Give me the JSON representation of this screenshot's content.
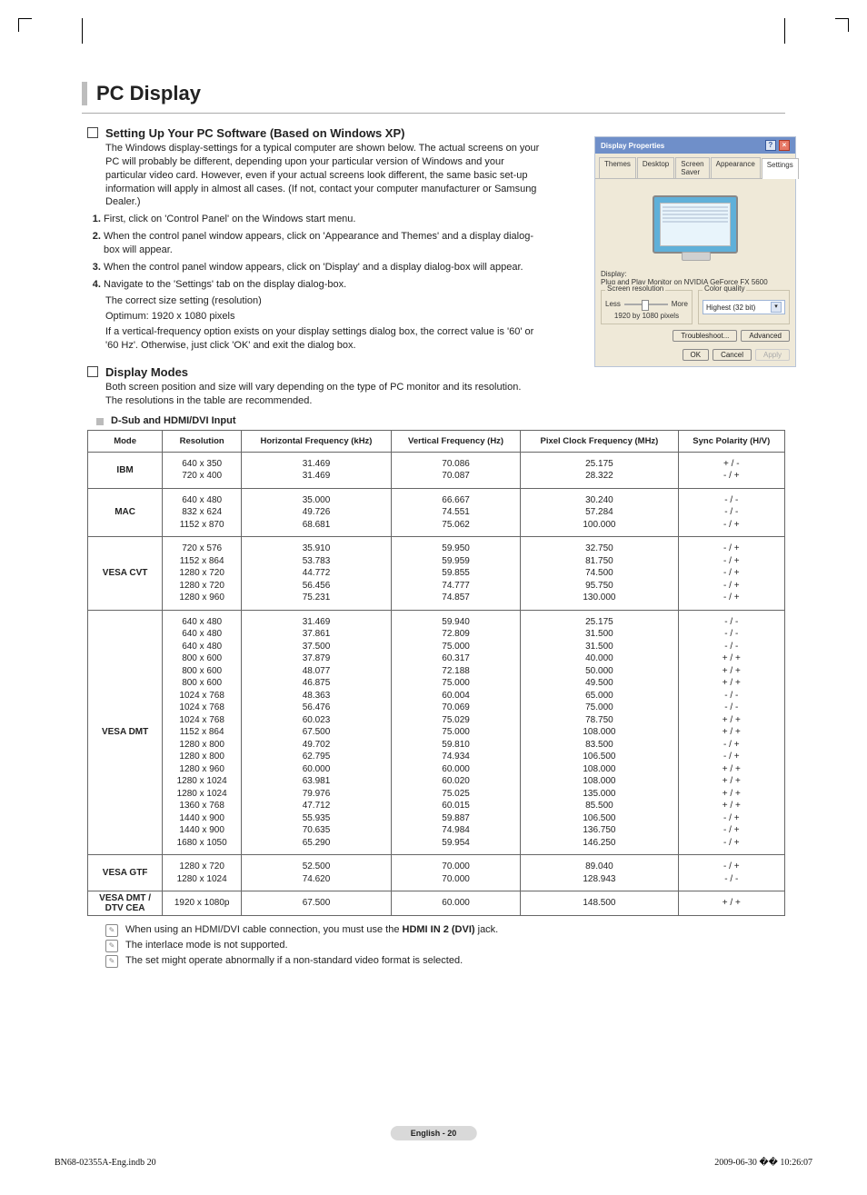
{
  "page_title": "PC Display",
  "section1": {
    "heading": "Setting Up Your PC Software (Based on Windows XP)",
    "intro": "The Windows display-settings for a typical computer are shown below. The actual screens on your PC will probably be different, depending upon your particular version of Windows and your particular video card. However, even if your actual screens look different, the same basic set-up information will apply in almost all cases. (If not, contact your computer manufacturer or Samsung Dealer.)",
    "steps": [
      "First, click on 'Control Panel' on the Windows start menu.",
      "When the control panel window appears, click on 'Appearance and Themes' and a display dialog-box will appear.",
      "When the control panel window appears, click on 'Display' and a display dialog-box will appear.",
      "Navigate to the 'Settings' tab on the display dialog-box."
    ],
    "after_steps": [
      "The correct size setting (resolution)",
      "Optimum: 1920 x 1080 pixels",
      "If a vertical-frequency option exists on your display settings dialog box, the correct value is '60' or '60 Hz'. Otherwise, just click 'OK' and exit the dialog box."
    ]
  },
  "section2": {
    "heading": "Display Modes",
    "body1": "Both screen position and size will vary depending on the type of PC monitor and its resolution.",
    "body2": "The resolutions in the table are recommended.",
    "subheading": "D-Sub and HDMI/DVI Input"
  },
  "table": {
    "headers": [
      "Mode",
      "Resolution",
      "Horizontal Frequency (kHz)",
      "Vertical Frequency (Hz)",
      "Pixel Clock Frequency (MHz)",
      "Sync Polarity (H/V)"
    ],
    "groups": [
      {
        "mode": "IBM",
        "rows": [
          [
            "640 x 350",
            "31.469",
            "70.086",
            "25.175",
            "+ / -"
          ],
          [
            "720 x 400",
            "31.469",
            "70.087",
            "28.322",
            "- / +"
          ]
        ]
      },
      {
        "mode": "MAC",
        "rows": [
          [
            "640 x 480",
            "35.000",
            "66.667",
            "30.240",
            "- / -"
          ],
          [
            "832 x 624",
            "49.726",
            "74.551",
            "57.284",
            "- / -"
          ],
          [
            "1152 x 870",
            "68.681",
            "75.062",
            "100.000",
            "- / +"
          ]
        ]
      },
      {
        "mode": "VESA CVT",
        "rows": [
          [
            "720 x 576",
            "35.910",
            "59.950",
            "32.750",
            "- / +"
          ],
          [
            "1152 x 864",
            "53.783",
            "59.959",
            "81.750",
            "- / +"
          ],
          [
            "1280 x 720",
            "44.772",
            "59.855",
            "74.500",
            "- / +"
          ],
          [
            "1280 x 720",
            "56.456",
            "74.777",
            "95.750",
            "- / +"
          ],
          [
            "1280 x 960",
            "75.231",
            "74.857",
            "130.000",
            "- / +"
          ]
        ]
      },
      {
        "mode": "VESA DMT",
        "rows": [
          [
            "640 x 480",
            "31.469",
            "59.940",
            "25.175",
            "- / -"
          ],
          [
            "640 x 480",
            "37.861",
            "72.809",
            "31.500",
            "- / -"
          ],
          [
            "640 x 480",
            "37.500",
            "75.000",
            "31.500",
            "- / -"
          ],
          [
            "800 x 600",
            "37.879",
            "60.317",
            "40.000",
            "+ / +"
          ],
          [
            "800 x 600",
            "48.077",
            "72.188",
            "50.000",
            "+ / +"
          ],
          [
            "800 x 600",
            "46.875",
            "75.000",
            "49.500",
            "+ / +"
          ],
          [
            "1024 x 768",
            "48.363",
            "60.004",
            "65.000",
            "- / -"
          ],
          [
            "1024 x 768",
            "56.476",
            "70.069",
            "75.000",
            "- / -"
          ],
          [
            "1024 x 768",
            "60.023",
            "75.029",
            "78.750",
            "+ / +"
          ],
          [
            "1152 x 864",
            "67.500",
            "75.000",
            "108.000",
            "+ / +"
          ],
          [
            "1280 x 800",
            "49.702",
            "59.810",
            "83.500",
            "- / +"
          ],
          [
            "1280 x 800",
            "62.795",
            "74.934",
            "106.500",
            "- / +"
          ],
          [
            "1280 x 960",
            "60.000",
            "60.000",
            "108.000",
            "+ / +"
          ],
          [
            "1280 x 1024",
            "63.981",
            "60.020",
            "108.000",
            "+ / +"
          ],
          [
            "1280 x 1024",
            "79.976",
            "75.025",
            "135.000",
            "+ / +"
          ],
          [
            "1360 x 768",
            "47.712",
            "60.015",
            "85.500",
            "+ / +"
          ],
          [
            "1440 x 900",
            "55.935",
            "59.887",
            "106.500",
            "- / +"
          ],
          [
            "1440 x 900",
            "70.635",
            "74.984",
            "136.750",
            "- / +"
          ],
          [
            "1680 x 1050",
            "65.290",
            "59.954",
            "146.250",
            "- / +"
          ]
        ]
      },
      {
        "mode": "VESA GTF",
        "rows": [
          [
            "1280 x 720",
            "52.500",
            "70.000",
            "89.040",
            "- / +"
          ],
          [
            "1280 x 1024",
            "74.620",
            "70.000",
            "128.943",
            "- / -"
          ]
        ]
      },
      {
        "mode": "VESA DMT / DTV CEA",
        "rows": [
          [
            "1920 x 1080p",
            "67.500",
            "60.000",
            "148.500",
            "+ / +"
          ]
        ]
      }
    ]
  },
  "notes": [
    {
      "pre": "When using an HDMI/DVI cable connection, you must use the ",
      "bold": "HDMI IN 2 (DVI)",
      "post": " jack."
    },
    {
      "pre": "The interlace mode is not supported.",
      "bold": "",
      "post": ""
    },
    {
      "pre": "The set might operate abnormally if a non-standard video format is selected.",
      "bold": "",
      "post": ""
    }
  ],
  "page_label": "English - 20",
  "footer": {
    "left": "BN68-02355A-Eng.indb   20",
    "right": "2009-06-30   �� 10:26:07"
  },
  "dialog": {
    "title": "Display Properties",
    "tabs": [
      "Themes",
      "Desktop",
      "Screen Saver",
      "Appearance",
      "Settings"
    ],
    "active_tab": 4,
    "display_label": "Display:",
    "display_value": "Plug and Play Monitor on NVIDIA GeForce FX 5600",
    "sr_label": "Screen resolution",
    "sr_less": "Less",
    "sr_more": "More",
    "sr_value": "1920 by 1080 pixels",
    "cq_label": "Color quality",
    "cq_value": "Highest (32 bit)",
    "troubleshoot": "Troubleshoot...",
    "advanced": "Advanced",
    "ok": "OK",
    "cancel": "Cancel",
    "apply": "Apply"
  }
}
